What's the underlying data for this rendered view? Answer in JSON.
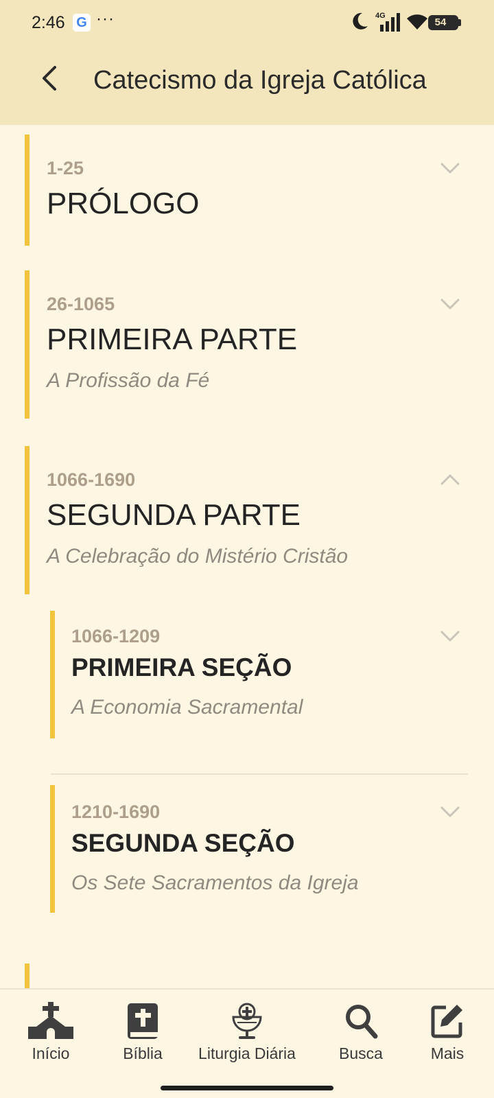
{
  "status_bar": {
    "time": "2:46",
    "google_letter": "G",
    "dots": "···",
    "network": "4G",
    "battery": "54"
  },
  "header": {
    "title": "Catecismo da Igreja Católica"
  },
  "parts": [
    {
      "range": "1-25",
      "title": "PRÓLOGO",
      "subtitle": "",
      "expanded": false
    },
    {
      "range": "26-1065",
      "title": "PRIMEIRA PARTE",
      "subtitle": "A Profissão da Fé",
      "expanded": false
    },
    {
      "range": "1066-1690",
      "title": "SEGUNDA PARTE",
      "subtitle": "A Celebração do Mistério Cristão",
      "expanded": true,
      "sections": [
        {
          "range": "1066-1209",
          "title": "PRIMEIRA SEÇÃO",
          "subtitle": "A Economia Sacramental"
        },
        {
          "range": "1210-1690",
          "title": "SEGUNDA SEÇÃO",
          "subtitle": "Os Sete Sacramentos da Igreja"
        }
      ]
    }
  ],
  "nav": [
    {
      "label": "Início",
      "icon": "church-icon"
    },
    {
      "label": "Bíblia",
      "icon": "bible-icon"
    },
    {
      "label": "Liturgia Diária",
      "icon": "chalice-icon"
    },
    {
      "label": "Busca",
      "icon": "search-icon"
    },
    {
      "label": "Mais",
      "icon": "edit-icon"
    }
  ],
  "colors": {
    "accent": "#f2c33d",
    "header_bg": "#f3e6bc",
    "page_bg": "#fdf6e3",
    "range_text": "#ad9f89"
  }
}
